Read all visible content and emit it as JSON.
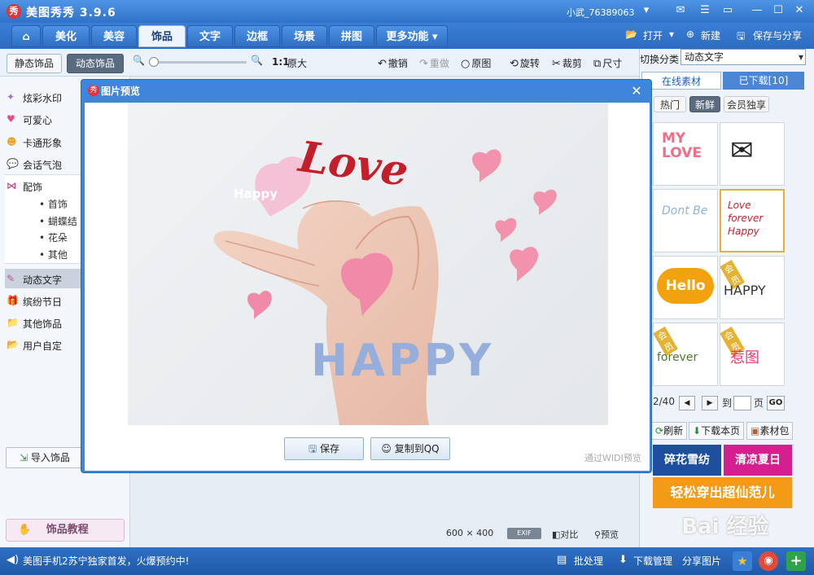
{
  "app": {
    "title": "美图秀秀 3.9.6",
    "logo_char": "秀",
    "user": "小武_76389063"
  },
  "main_tabs": [
    {
      "label": "美化"
    },
    {
      "label": "美容"
    },
    {
      "label": "饰品"
    },
    {
      "label": "文字"
    },
    {
      "label": "边框"
    },
    {
      "label": "场景"
    },
    {
      "label": "拼图"
    },
    {
      "label": "更多功能"
    }
  ],
  "header_actions": {
    "open": "打开",
    "new": "新建",
    "save_share": "保存与分享"
  },
  "sub_tabs": {
    "static": "静态饰品",
    "dynamic": "动态饰品"
  },
  "toolbar": {
    "ratio": "1:1",
    "original_size": "原大",
    "undo": "撤销",
    "redo": "重做",
    "original_image": "原图",
    "rotate": "旋转",
    "crop": "裁剪",
    "size": "尺寸"
  },
  "sidebar": {
    "items": [
      {
        "label": "炫彩水印",
        "icon": "sparkle-icon"
      },
      {
        "label": "可爱心",
        "icon": "heart-icon"
      },
      {
        "label": "卡通形象",
        "icon": "cartoon-icon"
      },
      {
        "label": "会话气泡",
        "icon": "bubble-icon"
      },
      {
        "label": "配饰",
        "icon": "bow-icon"
      }
    ],
    "sub_items": [
      "首饰",
      "蝴蝶结",
      "花朵",
      "其他"
    ],
    "items2": [
      {
        "label": "动态文字",
        "icon": "text-icon"
      },
      {
        "label": "缤纷节日",
        "icon": "gift-icon"
      },
      {
        "label": "其他饰品",
        "icon": "folder-icon"
      },
      {
        "label": "用户自定",
        "icon": "folder-plus-icon"
      }
    ],
    "import_label": "导入饰品",
    "tutorial_label": "饰品教程"
  },
  "right_panel": {
    "category_label": "切换分类",
    "category_value": "动态文字",
    "tabs": {
      "online": "在线素材",
      "downloaded": "已下载[10]"
    },
    "chips": [
      "热门",
      "新鲜",
      "会员独享"
    ],
    "thumbs": [
      {
        "label": "MY LOVE",
        "vip": false
      },
      {
        "label": "",
        "vip": false
      },
      {
        "label": "Dont Be",
        "vip": false
      },
      {
        "label": "Love forever Happy",
        "vip": false
      },
      {
        "label": "Hello",
        "vip": false
      },
      {
        "label": "HAPPY",
        "vip": true
      },
      {
        "label": "forever",
        "vip": true
      },
      {
        "label": "惹图",
        "vip": true
      }
    ],
    "vip_badge": "会员",
    "pager": {
      "current": "2/40",
      "goto_label": "到",
      "page_label": "页",
      "go": "GO"
    },
    "actions": {
      "refresh": "刷新",
      "download_page": "下载本页",
      "pack": "素材包"
    },
    "banners": [
      {
        "label": "碎花雪纺",
        "color": "#1d4f9e"
      },
      {
        "label": "清凉夏日",
        "color": "#d61f8e"
      },
      {
        "label": "轻松穿出超仙范儿",
        "color": "#f39a17"
      }
    ]
  },
  "dialog": {
    "title": "图片预览",
    "save": "保存",
    "copy_qq": "复制到QQ",
    "hint": "通过WIDI预览",
    "overlay": {
      "love": "Love",
      "happy": "HAPPY",
      "happy2": "Happy"
    }
  },
  "status": {
    "width": "600",
    "x": "×",
    "height": "400",
    "exif": "EXIF",
    "compare": "对比",
    "preview": "预览"
  },
  "bottom_bar": {
    "news": "美图手机2苏宁独家首发，火爆预约中!",
    "batch": "批处理",
    "download_mgr": "下载管理",
    "share": "分享图片"
  },
  "watermark": "Bai 经验"
}
